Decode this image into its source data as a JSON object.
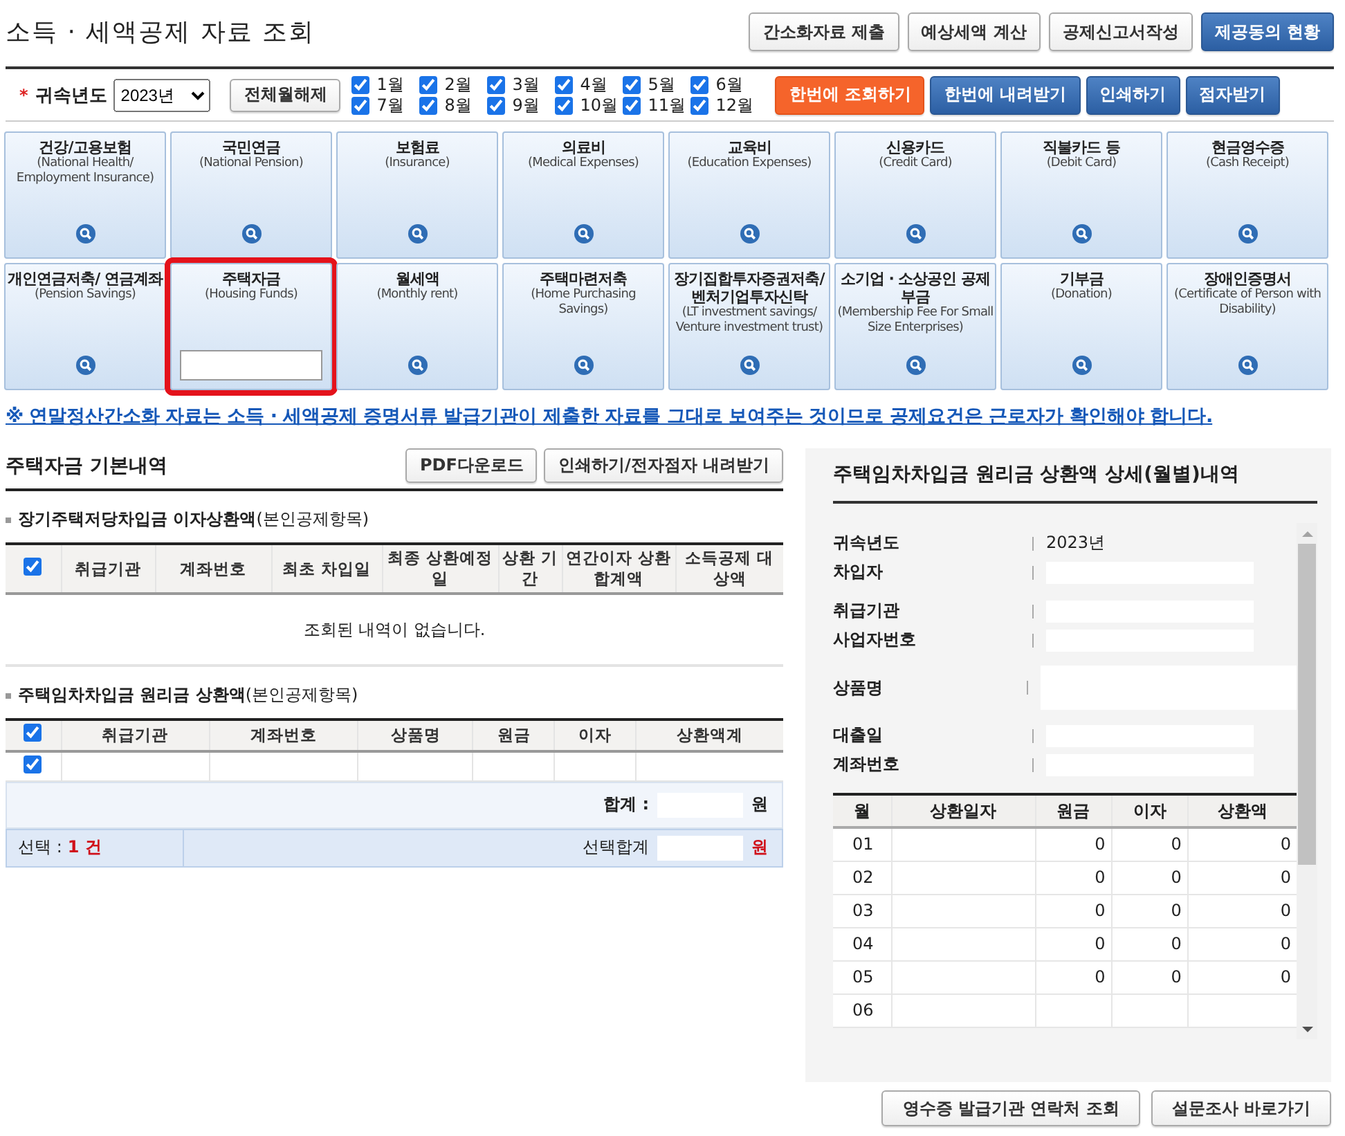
{
  "page_title": "소득 · 세액공제 자료 조회",
  "header_buttons": [
    {
      "label": "간소화자료 제출",
      "kind": "plain"
    },
    {
      "label": "예상세액 계산",
      "kind": "plain"
    },
    {
      "label": "공제신고서작성",
      "kind": "plain"
    },
    {
      "label": "제공동의 현황",
      "kind": "primary"
    }
  ],
  "filter": {
    "required_mark": "*",
    "label": "귀속년도",
    "year": "2023년",
    "toggle_button": "전체월해제",
    "months": [
      {
        "label": "1월",
        "checked": true
      },
      {
        "label": "2월",
        "checked": true
      },
      {
        "label": "3월",
        "checked": true
      },
      {
        "label": "4월",
        "checked": true
      },
      {
        "label": "5월",
        "checked": true
      },
      {
        "label": "6월",
        "checked": true
      },
      {
        "label": "7월",
        "checked": true
      },
      {
        "label": "8월",
        "checked": true
      },
      {
        "label": "9월",
        "checked": true
      },
      {
        "label": "10월",
        "checked": true
      },
      {
        "label": "11월",
        "checked": true
      },
      {
        "label": "12월",
        "checked": true
      }
    ],
    "actions": [
      {
        "label": "한번에 조회하기",
        "kind": "orange"
      },
      {
        "label": "한번에 내려받기",
        "kind": "blue"
      },
      {
        "label": "인쇄하기",
        "kind": "blue"
      },
      {
        "label": "점자받기",
        "kind": "blue"
      }
    ]
  },
  "categories": [
    {
      "title": "건강/고용보험",
      "subtitle": "(National Health/ Employment Insurance)",
      "highlighted": false
    },
    {
      "title": "국민연금",
      "subtitle": "(National Pension)",
      "highlighted": false
    },
    {
      "title": "보험료",
      "subtitle": "(Insurance)",
      "highlighted": false
    },
    {
      "title": "의료비",
      "subtitle": "(Medical Expenses)",
      "highlighted": false
    },
    {
      "title": "교육비",
      "subtitle": "(Education Expenses)",
      "highlighted": false
    },
    {
      "title": "신용카드",
      "subtitle": "(Credit Card)",
      "highlighted": false
    },
    {
      "title": "직불카드 등",
      "subtitle": "(Debit Card)",
      "highlighted": false
    },
    {
      "title": "현금영수증",
      "subtitle": "(Cash Receipt)",
      "highlighted": false
    },
    {
      "title": "개인연금저축/ 연금계좌",
      "subtitle": "(Pension Savings)",
      "highlighted": false
    },
    {
      "title": "주택자금",
      "subtitle": "(Housing Funds)",
      "highlighted": true
    },
    {
      "title": "월세액",
      "subtitle": "(Monthly rent)",
      "highlighted": false
    },
    {
      "title": "주택마련저축",
      "subtitle": "(Home Purchasing Savings)",
      "highlighted": false
    },
    {
      "title": "장기집합투자증권저축/ 벤처기업투자신탁",
      "subtitle": "(LT investment savings/ Venture investment trust)",
      "highlighted": false
    },
    {
      "title": "소기업 · 소상공인 공제부금",
      "subtitle": "(Membership Fee For Small Size Enterprises)",
      "highlighted": false
    },
    {
      "title": "기부금",
      "subtitle": "(Donation)",
      "highlighted": false
    },
    {
      "title": "장애인증명서",
      "subtitle": "(Certificate of Person with Disability)",
      "highlighted": false
    }
  ],
  "notice": "※ 연말정산간소화 자료는 소득 · 세액공제 증명서류 발급기관이 제출한 자료를 그대로 보여주는 것이므로 공제요건은 근로자가 확인해야 합니다.",
  "basic": {
    "title": "주택자금 기본내역",
    "buttons": [
      "PDF다운로드",
      "인쇄하기/전자점자 내려받기"
    ],
    "sections": [
      {
        "title": "**장기주택저당차입금 이자상환액**(본인공제항목)",
        "header_checked": true,
        "columns": [
          "취급기관",
          "계좌번호",
          "최초 차입일",
          "최종 상환예정일",
          "상환 기간",
          "연간이자 상환합계액",
          "소득공제 대상액"
        ],
        "empty_message": "조회된 내역이 없습니다."
      },
      {
        "title": "**주택임차차입금 원리금 상환액**(본인공제항목)",
        "header_checked": true,
        "columns": [
          "취급기관",
          "계좌번호",
          "상품명",
          "원금",
          "이자",
          "상환액계"
        ],
        "rows": [
          {
            "checked": true
          }
        ],
        "total": {
          "label": "합계 :",
          "redacted": true,
          "unit": "원"
        },
        "selection": {
          "label": "선택 :",
          "count": "1 건",
          "sum_label": "선택합계",
          "redacted": true,
          "unit": "원"
        }
      }
    ]
  },
  "detail": {
    "title": "주택임차차입금 원리금 상환액 상세(월별)내역",
    "fields": [
      {
        "label": "귀속년도",
        "value": "2023년"
      },
      {
        "label": "차입자",
        "redacted": true
      },
      {
        "label": "취급기관",
        "redacted": true
      },
      {
        "label": "사업자번호",
        "redacted": true
      },
      {
        "label": "상품명",
        "redacted": true
      },
      {
        "label": "대출일",
        "redacted": true
      },
      {
        "label": "계좌번호",
        "redacted": true
      }
    ],
    "columns": [
      "월",
      "상환일자",
      "원금",
      "이자",
      "상환액"
    ],
    "rows": [
      {
        "month": "01",
        "principal": "0",
        "interest": "0",
        "total": "0"
      },
      {
        "month": "02",
        "principal": "0",
        "interest": "0",
        "total": "0"
      },
      {
        "month": "03",
        "principal": "0",
        "interest": "0",
        "total": "0"
      },
      {
        "month": "04",
        "principal": "0",
        "interest": "0",
        "total": "0"
      },
      {
        "month": "05",
        "principal": "0",
        "interest": "0",
        "total": "0"
      },
      {
        "month": "06"
      }
    ]
  },
  "footer_buttons": [
    "영수증 발급기관 연락처 조회",
    "설문조사 바로가기"
  ]
}
